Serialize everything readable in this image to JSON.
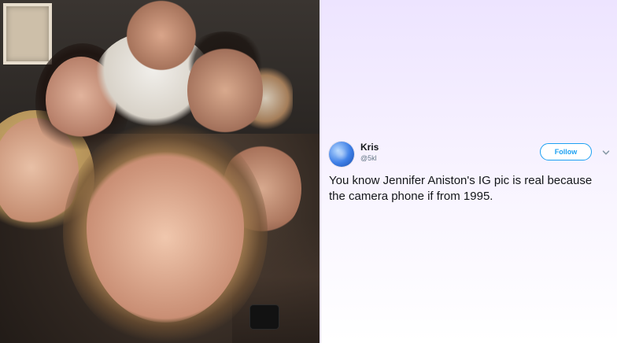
{
  "photo": {
    "description_icon": "group-selfie-photo"
  },
  "tweet": {
    "user_name": "Kris",
    "user_handle": "@5kl",
    "follow_label": "Follow",
    "text": "You know Jennifer Aniston's IG pic is real because the camera phone if from 1995.",
    "colors": {
      "accent": "#1da1f2",
      "name": "#14171a",
      "handle": "#657786",
      "panel_top": "#ede4ff"
    },
    "icons": {
      "avatar": "avatar-icon",
      "menu": "chevron-down-icon"
    }
  }
}
